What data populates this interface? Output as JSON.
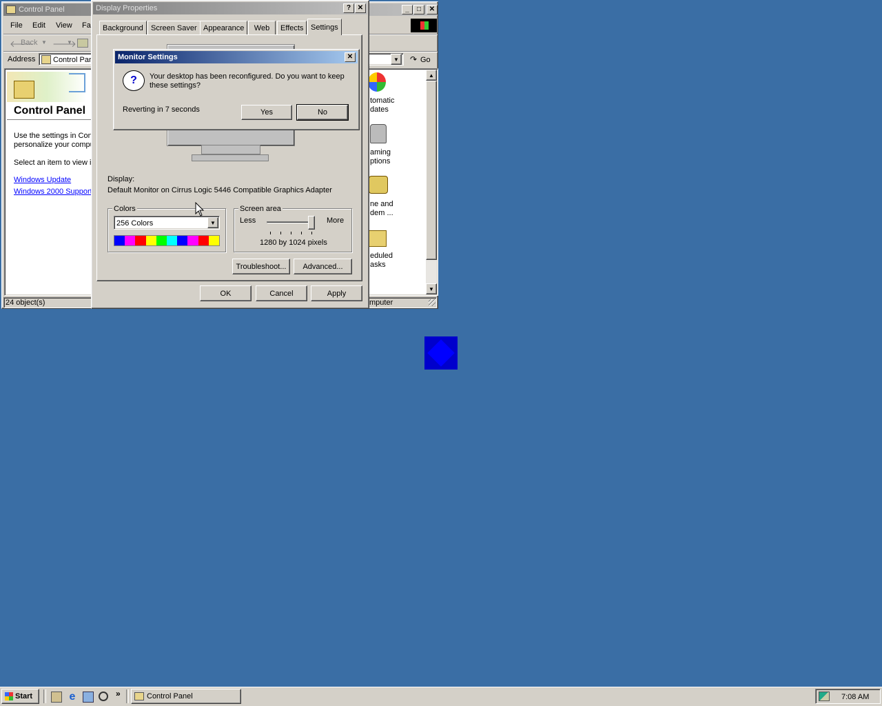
{
  "control_panel": {
    "title": "Control Panel",
    "menu": [
      "File",
      "Edit",
      "View",
      "Fa"
    ],
    "back_label": "Back",
    "address_label": "Address",
    "address_value": "Control Par",
    "go_label": "Go",
    "heading": "Control Panel",
    "desc1": "Use the settings in Cont",
    "desc2": "personalize your compu",
    "desc3": "Select an item to view it",
    "link_update": "Windows Update",
    "link_support": "Windows 2000 Support",
    "status_left": "24 object(s)",
    "status_right": "mputer",
    "icons": [
      {
        "line1": "tomatic",
        "line2": "dates"
      },
      {
        "line1": "aming",
        "line2": "ptions"
      },
      {
        "line1": "ne and",
        "line2": "dem ..."
      },
      {
        "line1": "eduled",
        "line2": "asks"
      }
    ]
  },
  "display_properties": {
    "title": "Display Properties",
    "help_glyph": "?",
    "close_glyph": "✕",
    "tabs": [
      "Background",
      "Screen Saver",
      "Appearance",
      "Web",
      "Effects",
      "Settings"
    ],
    "display_label": "Display:",
    "display_value": "Default Monitor on Cirrus Logic 5446 Compatible Graphics Adapter",
    "colors_group": "Colors",
    "colors_value": "256 Colors",
    "screen_area_group": "Screen area",
    "less_label": "Less",
    "more_label": "More",
    "resolution": "1280 by 1024 pixels",
    "troubleshoot": "Troubleshoot...",
    "advanced": "Advanced...",
    "ok": "OK",
    "cancel": "Cancel",
    "apply": "Apply",
    "color_bar": [
      "#0000ff",
      "#ff00ff",
      "#ff0000",
      "#ffff00",
      "#00ff00",
      "#00ffff",
      "#0000ff",
      "#ff00ff",
      "#ff0000",
      "#ffff00"
    ]
  },
  "monitor_settings": {
    "title": "Monitor Settings",
    "message_line1": "Your desktop has been reconfigured.  Do you want to keep",
    "message_line2": "these settings?",
    "countdown": "Reverting in 7 seconds",
    "yes": "Yes",
    "no": "No"
  },
  "taskbar": {
    "start": "Start",
    "task_label": "Control Panel",
    "clock": "7:08 AM",
    "more_glyph": "»"
  },
  "colors": {
    "desktop": "#3a6ea5",
    "face": "#d4d0c8",
    "active_title": "#0a246a",
    "inactive_title": "#808080"
  }
}
